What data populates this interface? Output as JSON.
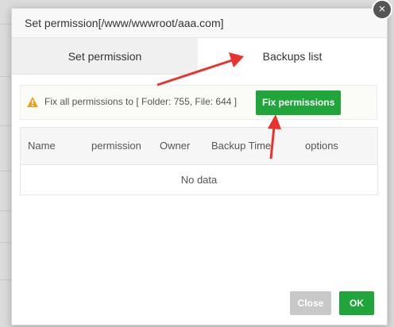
{
  "dialog": {
    "title": "Set permission[/www/wwwroot/aaa.com]",
    "close_glyph": "×"
  },
  "tabs": [
    {
      "label": "Set permission",
      "active": false
    },
    {
      "label": "Backups list",
      "active": true
    }
  ],
  "notice": {
    "icon": "warning-icon",
    "text": "Fix all permissions to [ Folder: 755, File: 644 ]",
    "button_label": "Fix permissions"
  },
  "table": {
    "columns": [
      "Name",
      "permission",
      "Owner",
      "Backup Time",
      "options"
    ],
    "empty_text": "No data"
  },
  "footer": {
    "close_label": "Close",
    "ok_label": "OK"
  },
  "colors": {
    "accent_green": "#20a53a",
    "disabled_gray": "#c8c8c8",
    "annotation_red": "#e8332e",
    "warning_orange": "#f0a020"
  }
}
